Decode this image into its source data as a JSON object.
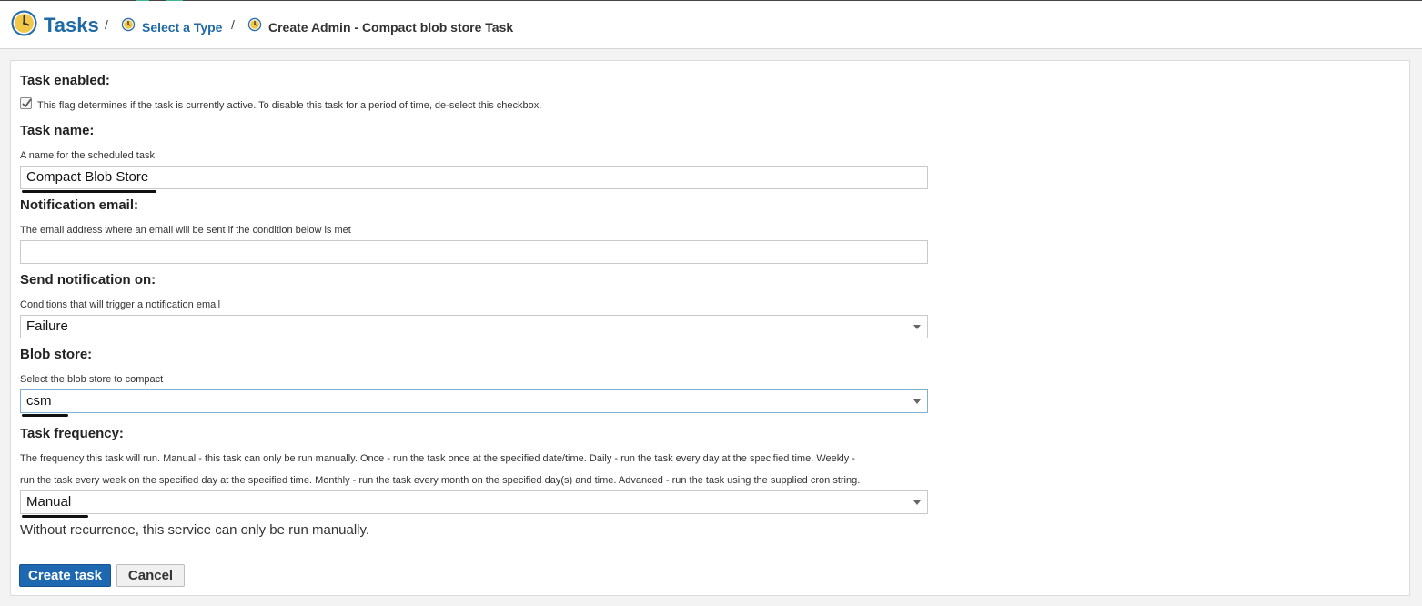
{
  "breadcrumb": {
    "root": "Tasks",
    "separator": "/",
    "step": "Select a Type",
    "current": "Create Admin - Compact blob store Task"
  },
  "form": {
    "enabled": {
      "label": "Task enabled:",
      "help": "This flag determines if the task is currently active. To disable this task for a period of time, de-select this checkbox.",
      "checked": true
    },
    "name": {
      "label": "Task name:",
      "help": "A name for the scheduled task",
      "value": "Compact Blob Store"
    },
    "email": {
      "label": "Notification email:",
      "help": "The email address where an email will be sent if the condition below is met",
      "value": ""
    },
    "notify_on": {
      "label": "Send notification on:",
      "help": "Conditions that will trigger a notification email",
      "value": "Failure"
    },
    "blob_store": {
      "label": "Blob store:",
      "help": "Select the blob store to compact",
      "value": "csm"
    },
    "frequency": {
      "label": "Task frequency:",
      "help_line1": "The frequency this task will run. Manual - this task can only be run manually. Once - run the task once at the specified date/time. Daily - run the task every day at the specified time. Weekly -",
      "help_line2": "run the task every week on the specified day at the specified time. Monthly - run the task every month on the specified day(s) and time. Advanced - run the task using the supplied cron string.",
      "value": "Manual",
      "note": "Without recurrence, this service can only be run manually."
    }
  },
  "buttons": {
    "create": "Create task",
    "cancel": "Cancel"
  },
  "colors": {
    "accent": "#1f69a6",
    "primary_button": "#1d68b0",
    "focus_border": "#7fb0d4"
  },
  "icons": {
    "tasks": "clock-icon",
    "select_type": "clock-icon",
    "current": "clock-icon",
    "dropdown": "chevron-down-icon",
    "checkbox": "checkmark-icon"
  }
}
